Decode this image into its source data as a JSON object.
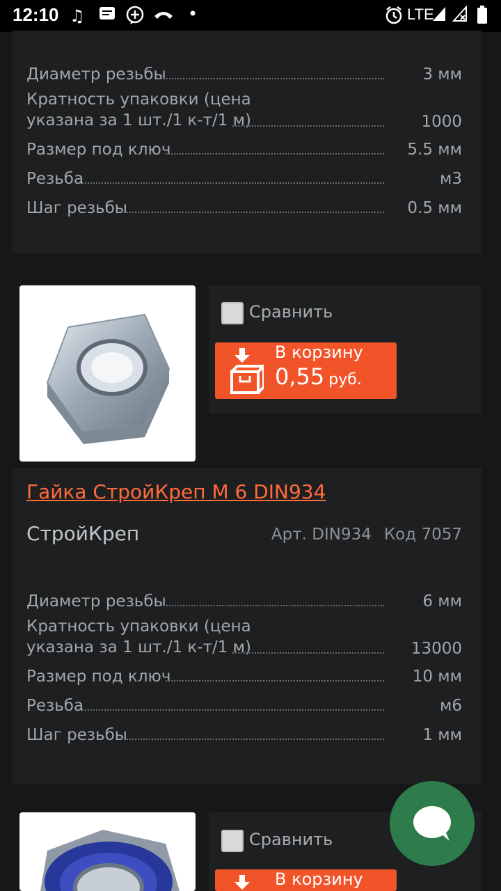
{
  "status_bar": {
    "time": "12:10",
    "network": "LTE",
    "icons": [
      "music-note-icon",
      "message-icon",
      "add-circle-icon",
      "missed-call-icon",
      "dot-icon",
      "alarm-icon",
      "signal-icon",
      "signal-no-data-icon",
      "battery-icon"
    ]
  },
  "products": [
    {
      "specs": [
        {
          "label": "Диаметр резьбы",
          "value": "3 мм"
        },
        {
          "label_lines": [
            "Кратность упаковки (цена",
            "указана за 1 шт./1 к-т/1 м)"
          ],
          "value": "1000"
        },
        {
          "label": "Размер под ключ",
          "value": "5.5 мм"
        },
        {
          "label": "Резьба",
          "value": "м3"
        },
        {
          "label": "Шаг резьбы",
          "value": "0.5 мм"
        }
      ]
    },
    {
      "compare_label": "Сравнить",
      "cart_label": "В корзину",
      "price": "0,55",
      "currency": "руб.",
      "title": "Гайка СтройКреп М 6 DIN934",
      "brand": "СтройКреп",
      "article": "Арт. DIN934",
      "code": "Код 7057",
      "specs": [
        {
          "label": "Диаметр резьбы",
          "value": "6 мм"
        },
        {
          "label_lines": [
            "Кратность упаковки (цена",
            "указана за 1 шт./1 к-т/1 м)"
          ],
          "value": "13000"
        },
        {
          "label": "Размер под ключ",
          "value": "10 мм"
        },
        {
          "label": "Резьба",
          "value": "м6"
        },
        {
          "label": "Шаг резьбы",
          "value": "1 мм"
        }
      ]
    },
    {
      "compare_label": "Сравнить",
      "cart_label": "В корзину"
    }
  ],
  "colors": {
    "accent": "#f2542a",
    "link": "#ff6a3b",
    "chat": "#2e7c4b",
    "background": "#161718",
    "panel": "#1d1f21"
  }
}
